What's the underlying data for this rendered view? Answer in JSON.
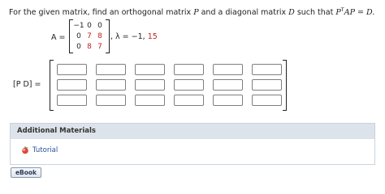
{
  "problem": {
    "text_before": "For the given matrix, find an orthogonal matrix ",
    "var_p": "P",
    "text_mid": " and a diagonal matrix ",
    "var_d": "D",
    "text_after": " such that ",
    "var_p2": "P",
    "superscript_t": "T",
    "equation_tail": "AP = D."
  },
  "matrix_a": {
    "label": "A =",
    "rows": [
      [
        "−1",
        "0",
        "0"
      ],
      [
        "0",
        "7",
        "8"
      ],
      [
        "0",
        "8",
        "7"
      ]
    ],
    "highlight_color": "#c41e1e"
  },
  "eigenvalues": {
    "prefix": ", λ = −1, ",
    "highlighted": "15"
  },
  "answer_matrix": {
    "label": "[P D]  =",
    "rows": 3,
    "columns": 6
  },
  "additional_materials": {
    "title": "Additional Materials",
    "link_icon": "tutorial-icon",
    "link_label": "Tutorial"
  },
  "ebook_button": {
    "label": "eBook"
  }
}
